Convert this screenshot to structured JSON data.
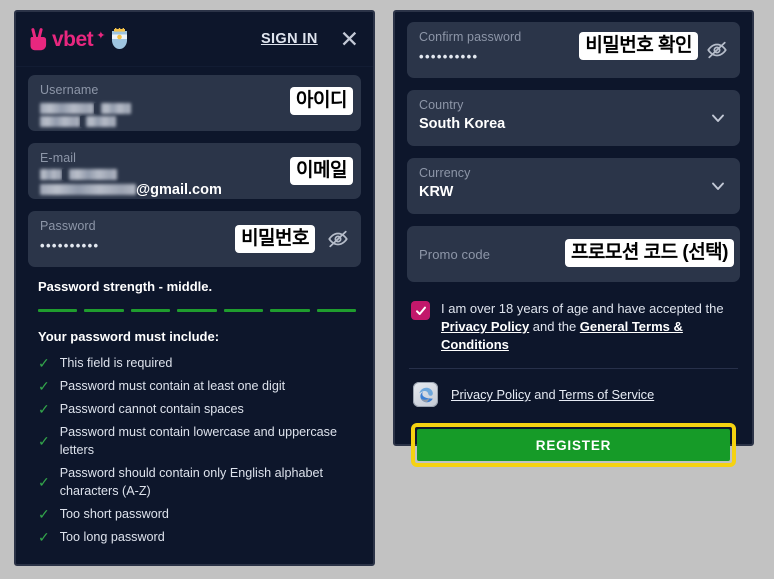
{
  "brand": {
    "logo_word": "vbet",
    "logo_spark": "✦",
    "logo_hand_icon": "peace-hand-icon",
    "logo_badge_icon": "argentina-crest-icon"
  },
  "header": {
    "sign_in_label": "SIGN IN",
    "close_label": "✕"
  },
  "left_form": {
    "username": {
      "label": "Username",
      "value_masked": true,
      "annotation": "아이디"
    },
    "email": {
      "label": "E-mail",
      "value_suffix": "@gmail.com",
      "annotation": "이메일"
    },
    "password": {
      "label": "Password",
      "value": "••••••••••",
      "annotation": "비밀번호",
      "toggle_icon": "eye-off-icon"
    }
  },
  "password_strength": {
    "title": "Password strength - middle.",
    "segments": 7,
    "segment_color": "#1f9d2e",
    "must_include_title": "Your password must include:",
    "rules": [
      "This field is required",
      "Password must contain at least one digit",
      "Password cannot contain spaces",
      "Password must contain lowercase and uppercase letters",
      "Password should contain only English alphabet characters (A-Z)",
      "Too short password",
      "Too long password"
    ],
    "rule_check_glyph": "✓"
  },
  "right_form": {
    "confirm_password": {
      "label": "Confirm password",
      "value": "••••••••••",
      "annotation": "비밀번호 확인",
      "toggle_icon": "eye-off-icon"
    },
    "country": {
      "label": "Country",
      "value": "South Korea",
      "chevron_icon": "chevron-down-icon"
    },
    "currency": {
      "label": "Currency",
      "value": "KRW",
      "chevron_icon": "chevron-down-icon"
    },
    "promo": {
      "label": "Promo code",
      "value": "",
      "annotation": "프로모션 코드 (선택)"
    }
  },
  "agreement": {
    "checked": true,
    "checkbox_color": "#c2186b",
    "text_part1": "I am over 18 years of age and have accepted the",
    "link1": "Privacy Policy",
    "text_part2": "and the",
    "link2": "General Terms & Conditions"
  },
  "password_save_bar": {
    "icon": "edge-browser-icon",
    "link1": "Privacy Policy",
    "joiner": "and",
    "link2": "Terms of Service"
  },
  "register": {
    "label": "REGISTER",
    "button_color": "#169b28",
    "highlight_color": "#f5d211"
  }
}
